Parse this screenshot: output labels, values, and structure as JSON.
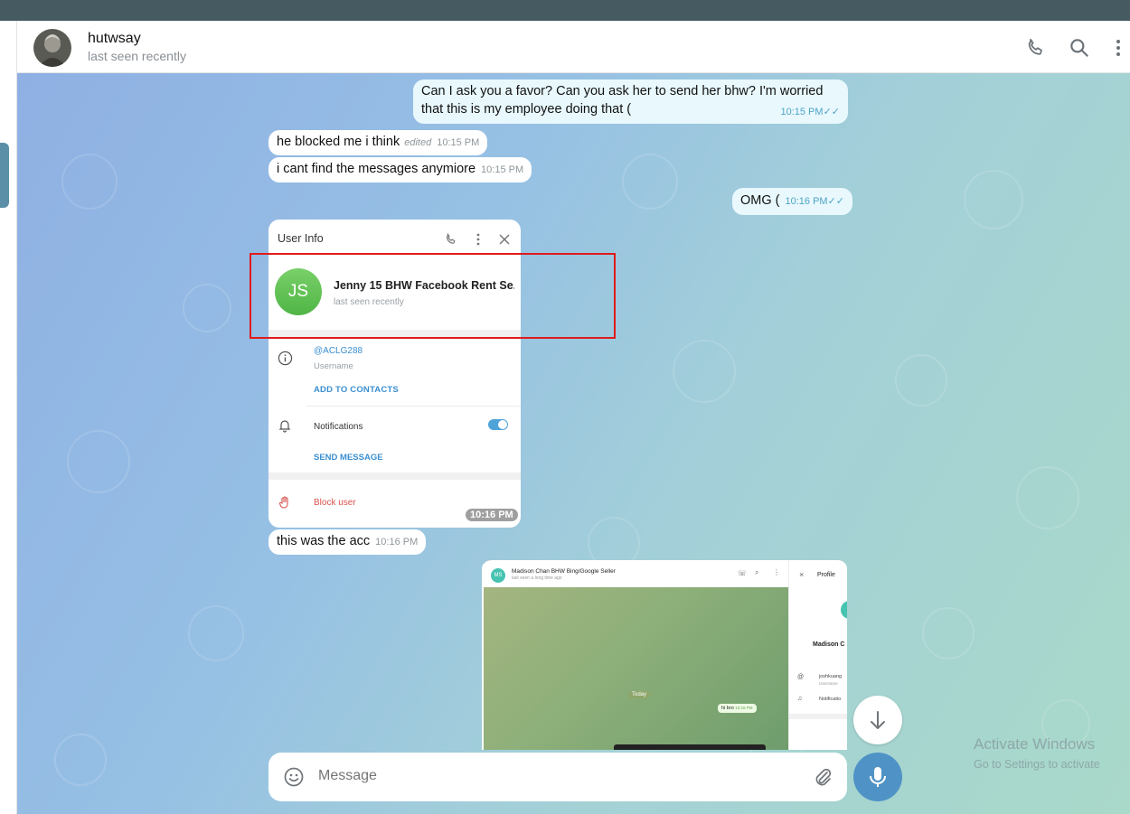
{
  "header": {
    "title": "hutwsay",
    "status": "last seen recently"
  },
  "messages": [
    {
      "text": "Can I ask you a favor? Can you ask her to send her bhw? I'm worried",
      "text2": "that this is my employee doing that (",
      "time": "10:15 PM",
      "direction": "out"
    },
    {
      "text": "he blocked me i think",
      "edited": "edited",
      "time": "10:15 PM",
      "direction": "in"
    },
    {
      "text": "i cant find the messages anymiore",
      "time": "10:15 PM",
      "direction": "in"
    },
    {
      "text": "OMG (",
      "time": "10:16 PM",
      "direction": "out"
    },
    {
      "text": "this was the acc",
      "time": "10:16 PM",
      "direction": "in"
    }
  ],
  "screenshot1": {
    "title": "User Info",
    "avatar_initials": "JS",
    "name": "Jenny 15 BHW Facebook Rent Se...",
    "status": "last seen recently",
    "username": "@ACLG288",
    "username_label": "Username",
    "add_contacts": "ADD TO CONTACTS",
    "notifications": "Notifications",
    "notifications_on": true,
    "send_message": "SEND MESSAGE",
    "block_user": "Block user",
    "time": "10:16 PM"
  },
  "screenshot2": {
    "avatar_initials": "MS",
    "chat_name": "Madison Chan BHW Bing/Google Seller",
    "chat_status": "last seen a long time ago",
    "today": "Today",
    "msg": "hi bro",
    "msg_time": "10:16 PM",
    "profile_title": "Profile",
    "profile_name": "Madison C",
    "profile_username": "joshkuang",
    "profile_username_label": "Username",
    "profile_notifications": "Notificatio"
  },
  "composer": {
    "placeholder": "Message"
  },
  "watermark": {
    "line1": "Activate Windows",
    "line2": "Go to Settings to activate"
  },
  "colors": {
    "accent": "#4f93c6",
    "highlight": "#e01b1b",
    "check": "#4fa4c7"
  }
}
